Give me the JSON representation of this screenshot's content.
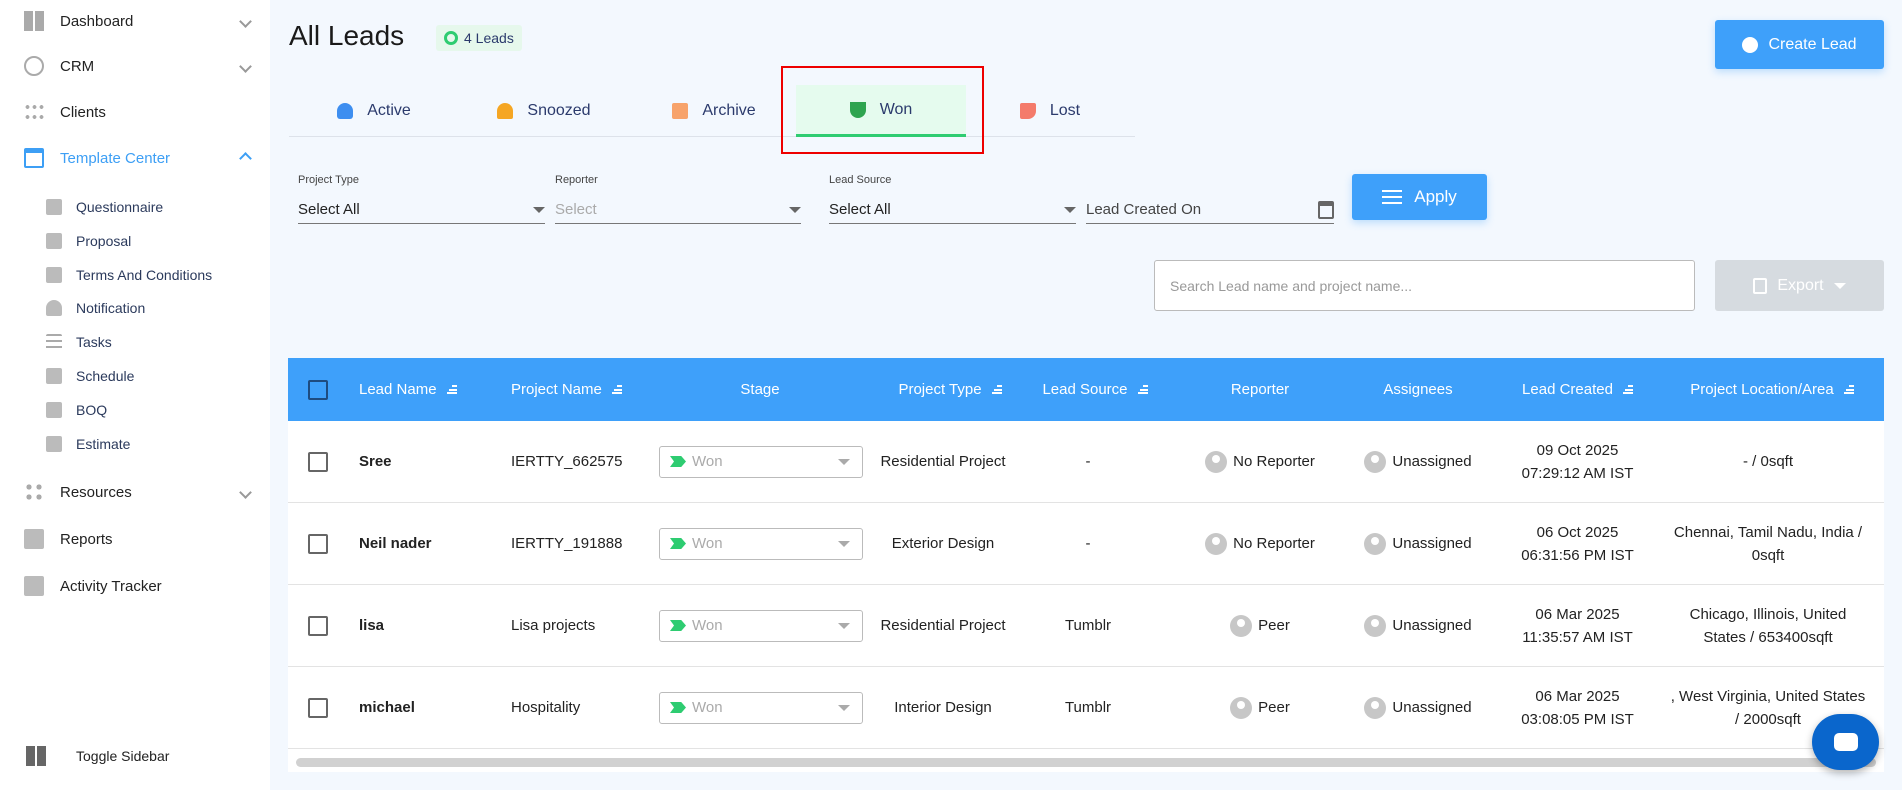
{
  "sidebar": {
    "main": [
      {
        "label": "Dashboard"
      },
      {
        "label": "CRM"
      },
      {
        "label": "Clients"
      },
      {
        "label": "Template Center"
      }
    ],
    "sub": [
      {
        "label": "Questionnaire"
      },
      {
        "label": "Proposal"
      },
      {
        "label": "Terms And Conditions"
      },
      {
        "label": "Notification"
      },
      {
        "label": "Tasks"
      },
      {
        "label": "Schedule"
      },
      {
        "label": "BOQ"
      },
      {
        "label": "Estimate"
      }
    ],
    "bottom": [
      {
        "label": "Resources"
      },
      {
        "label": "Reports"
      },
      {
        "label": "Activity Tracker"
      }
    ],
    "toggle": "Toggle Sidebar"
  },
  "header": {
    "title": "All Leads",
    "count": "4 Leads",
    "create": "Create Lead"
  },
  "tabs": [
    {
      "label": "Active"
    },
    {
      "label": "Snoozed"
    },
    {
      "label": "Archive"
    },
    {
      "label": "Won"
    },
    {
      "label": "Lost"
    }
  ],
  "filters": {
    "project_type": {
      "label": "Project Type",
      "value": "Select All"
    },
    "reporter": {
      "label": "Reporter",
      "placeholder": "Select"
    },
    "lead_source": {
      "label": "Lead Source",
      "value": "Select All"
    },
    "created_on": {
      "placeholder": "Lead Created On"
    },
    "apply": "Apply"
  },
  "search": {
    "placeholder": "Search Lead name and project name..."
  },
  "export": "Export",
  "table": {
    "headers": [
      "Lead Name",
      "Project Name",
      "Stage",
      "Project Type",
      "Lead Source",
      "Reporter",
      "Assignees",
      "Lead Created",
      "Project Location/Area"
    ],
    "rows": [
      {
        "name": "Sree",
        "project": "IERTTY_662575",
        "stage": "Won",
        "type": "Residential Project",
        "source": "-",
        "reporter": "No Reporter",
        "assignee": "Unassigned",
        "date": "09 Oct 2025",
        "time": "07:29:12 AM IST",
        "location": "- / 0sqft"
      },
      {
        "name": "Neil nader",
        "project": "IERTTY_191888",
        "stage": "Won",
        "type": "Exterior Design",
        "source": "-",
        "reporter": "No Reporter",
        "assignee": "Unassigned",
        "date": "06 Oct 2025",
        "time": "06:31:56 PM IST",
        "location": "Chennai, Tamil Nadu, India / 0sqft"
      },
      {
        "name": "lisa",
        "project": "Lisa projects",
        "stage": "Won",
        "type": "Residential Project",
        "source": "Tumblr",
        "reporter": "Peer",
        "assignee": "Unassigned",
        "date": "06 Mar 2025",
        "time": "11:35:57 AM IST",
        "location": "Chicago, Illinois, United States / 653400sqft"
      },
      {
        "name": "michael",
        "project": "Hospitality",
        "stage": "Won",
        "type": "Interior Design",
        "source": "Tumblr",
        "reporter": "Peer",
        "assignee": "Unassigned",
        "date": "06 Mar 2025",
        "time": "03:08:05 PM IST",
        "location": ", West Virginia, United States / 2000sqft"
      }
    ]
  },
  "colors": {
    "accent": "#3ea0fa",
    "won": "#2ecc71",
    "highlight": "#ee0000"
  }
}
